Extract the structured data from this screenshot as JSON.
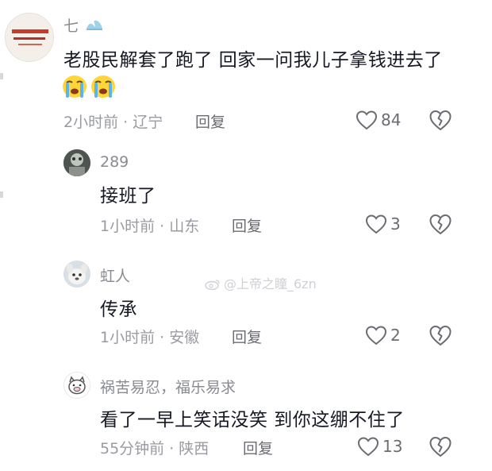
{
  "comments": [
    {
      "username": "七",
      "username_icon": "wave-emoji",
      "text": "老股民解套了跑了 回家一问我儿子拿钱进去了",
      "emojis": [
        "crying-emoji",
        "crying-emoji"
      ],
      "time": "2小时前 · 辽宁",
      "reply_label": "回复",
      "likes": "84"
    },
    {
      "username": "289",
      "text": "接班了",
      "time": "1小时前 · 山东",
      "reply_label": "回复",
      "likes": "3"
    },
    {
      "username": "虹人",
      "text": "传承",
      "time": "1小时前 · 安徽",
      "reply_label": "回复",
      "likes": "2"
    },
    {
      "username": "祸苦易忍，福乐易求",
      "text": "看了一早上笑话没笑 到你这绷不住了",
      "time": "55分钟前 · 陕西",
      "reply_label": "回复",
      "likes": "13"
    }
  ],
  "watermark": "@上帝之瞳_6zn",
  "colors": {
    "text": "#161823",
    "meta": "#9a9ba1",
    "username": "#8a8b91",
    "watermark": "#cfd0d4"
  }
}
